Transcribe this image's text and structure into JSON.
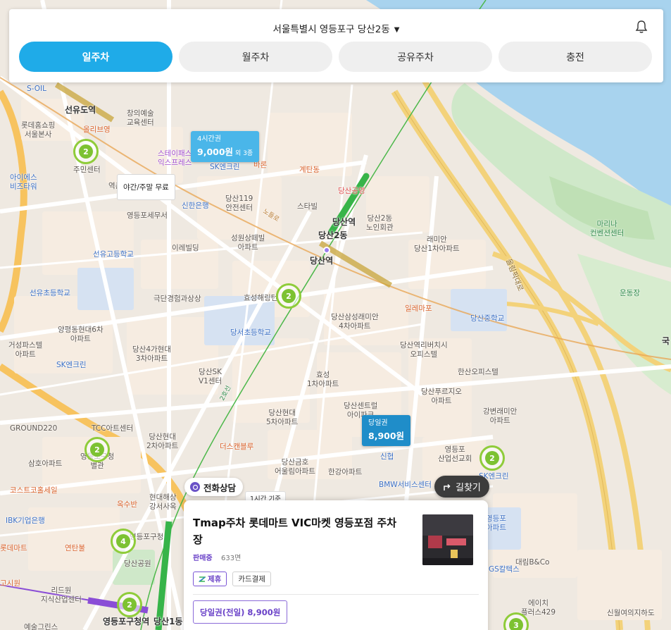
{
  "header": {
    "location": "서울특별시 영등포구 당산2동",
    "caret": "▼"
  },
  "tabs": [
    {
      "label": "일주차",
      "active": true
    },
    {
      "label": "월주차",
      "active": false
    },
    {
      "label": "공유주차",
      "active": false
    },
    {
      "label": "충전",
      "active": false
    }
  ],
  "map": {
    "price_tag_1": {
      "top": "4시간권",
      "price": "9,000원",
      "extra": "외 3종"
    },
    "price_tag_2": {
      "top": "당일권",
      "price": "8,900원"
    },
    "night_tag": "야간/주말 무료",
    "small_chip": "1시간 기준",
    "parking_counts": [
      "2",
      "2",
      "2",
      "2",
      "2",
      "4",
      "2",
      "3"
    ],
    "labels": {
      "l1": "선유도역",
      "l2": "롯데홈쇼핑\n서울본사",
      "l3": "S-OIL",
      "l4": "창의예술\n교육센터",
      "l5": "올리브영",
      "l6": "아이에스\n비즈타워",
      "l7": "주민센터",
      "l8": "스테이패스\n익스프레스",
      "l9": "SK엔크린",
      "l10": "바론",
      "l11": "계탄동",
      "l12": "당산119\n안전센터",
      "l13": "신한은행",
      "l14": "영등포세무서",
      "l15": "스타빌",
      "l16": "당산역",
      "l17": "당산2동\n노인회관",
      "l18": "래미안\n당산1차아파트",
      "l19": "성원상떼빌\n아파트",
      "l20": "이레빌딩",
      "l21": "선유고등학교",
      "l22": "당산2동",
      "l23": "당산역",
      "l24": "일레마포",
      "l25": "효성해링턴",
      "l26": "극단경험과상상",
      "l27": "당서초등학교",
      "l28": "선유초등학교",
      "l29": "양평동현대6차\n아파트",
      "l30": "거성파스텔\n아파트",
      "l31": "SK엔크린",
      "l32": "당산4가현대\n3차아파트",
      "l33": "당산삼성래미안\n4차아파트",
      "l34": "당산역리버치시\n오피스텔",
      "l35": "당산공원",
      "l36": "당산SK\nV1센터",
      "l37": "효성\n1차아파트",
      "l38": "당산센트럴\n아이파크",
      "l39": "당산푸르지오\n아파트",
      "l40": "한산오피스텔",
      "l41": "강변래미안\n아파트",
      "l42": "당산현대\n5차아파트",
      "l43": "GROUND220",
      "l44": "TCC아트센터",
      "l45": "당산현대\n2차아파트",
      "l46": "삼호아파트",
      "l47": "더스캔블루",
      "l48": "당산금호\n어울림아파트",
      "l49": "한강아파트",
      "l50": "신협",
      "l51": "영등포\n산업선교회",
      "l52": "SK엔크린",
      "l53": "코스트코홀세일",
      "l54": "BMW서비스센터",
      "l55": "IBK기업은행",
      "l56": "현대해상\n강서사옥",
      "l57": "옥수반",
      "l58": "롯데마트",
      "l59": "연탄불",
      "l60": "영등포구청",
      "l61": "리드원\n지식산업센터",
      "l62": "영등포구청역",
      "l63": "당산1동",
      "l64": "에이치\n플러스429",
      "l65": "대림B&Co",
      "l66": "신월여의지하도",
      "l67": "마리나\n컨벤션센터",
      "l68": "운동장",
      "l69": "당산중학교",
      "l70": "영등포\n아파트",
      "l71": "예술그린스",
      "l72": "고시원",
      "l73": "역촌",
      "l74": "GS칼텍스",
      "l75": "영등포구청\n별관",
      "l76": "당산공영",
      "l77": "올림픽대로",
      "l78": "국",
      "l79": "2호선",
      "l80": "노들로"
    }
  },
  "buttons": {
    "phone": "전화상담",
    "directions": "길찾기"
  },
  "card": {
    "title": "Tmap주차 롯데마트 VIC마켓 영등포점 주차장",
    "status": "판매중",
    "spaces": "633면",
    "badges": {
      "partner": "제휴",
      "card": "카드결제"
    },
    "ticket": "당일권(전일) 8,900원"
  },
  "colors": {
    "accent": "#1fabe8",
    "purple": "#6a42c8",
    "river": "#a8d3ee",
    "parking_green": "#7dc232"
  }
}
